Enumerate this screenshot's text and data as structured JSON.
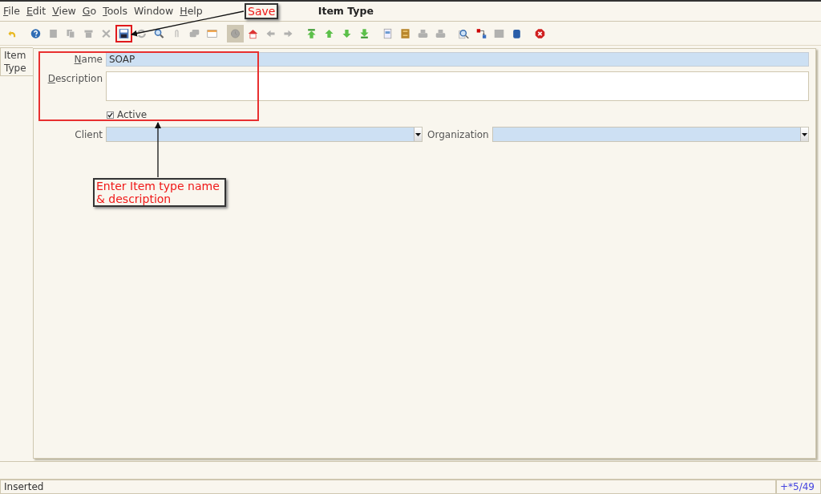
{
  "window": {
    "title": "Item Type"
  },
  "menu": [
    {
      "label": "File",
      "underline_first": true
    },
    {
      "label": "Edit",
      "underline_first": true
    },
    {
      "label": "View",
      "underline_first": true
    },
    {
      "label": "Go",
      "underline_first": true
    },
    {
      "label": "Tools",
      "underline_first": true
    },
    {
      "label": "Window",
      "underline_first": false
    },
    {
      "label": "Help",
      "underline_first": true
    }
  ],
  "toolbar_groups": [
    [
      {
        "kind": "undo",
        "disabled": false,
        "pressed": false,
        "highlighted": false
      }
    ],
    [
      {
        "kind": "help",
        "disabled": false,
        "pressed": false,
        "highlighted": false
      },
      {
        "kind": "new",
        "disabled": true,
        "pressed": false,
        "highlighted": false
      },
      {
        "kind": "copy",
        "disabled": true,
        "pressed": false,
        "highlighted": false
      },
      {
        "kind": "delete",
        "disabled": true,
        "pressed": false,
        "highlighted": false
      },
      {
        "kind": "delete-selection",
        "disabled": true,
        "pressed": false,
        "highlighted": false
      },
      {
        "kind": "save",
        "disabled": false,
        "pressed": false,
        "highlighted": true
      },
      {
        "kind": "refresh",
        "disabled": true,
        "pressed": false,
        "highlighted": false
      },
      {
        "kind": "find",
        "disabled": false,
        "pressed": false,
        "highlighted": false
      },
      {
        "kind": "attachment",
        "disabled": true,
        "pressed": false,
        "highlighted": false
      },
      {
        "kind": "chat",
        "disabled": true,
        "pressed": false,
        "highlighted": false
      },
      {
        "kind": "grid",
        "disabled": false,
        "pressed": false,
        "highlighted": false
      }
    ],
    [
      {
        "kind": "history",
        "disabled": true,
        "pressed": true,
        "highlighted": false
      },
      {
        "kind": "home",
        "disabled": false,
        "pressed": false,
        "highlighted": false
      },
      {
        "kind": "back",
        "disabled": true,
        "pressed": false,
        "highlighted": false
      },
      {
        "kind": "forward",
        "disabled": true,
        "pressed": false,
        "highlighted": false
      }
    ],
    [
      {
        "kind": "first",
        "disabled": false,
        "pressed": false,
        "highlighted": false
      },
      {
        "kind": "previous",
        "disabled": false,
        "pressed": false,
        "highlighted": false
      },
      {
        "kind": "next",
        "disabled": false,
        "pressed": false,
        "highlighted": false
      },
      {
        "kind": "last",
        "disabled": false,
        "pressed": false,
        "highlighted": false
      }
    ],
    [
      {
        "kind": "report",
        "disabled": false,
        "pressed": false,
        "highlighted": false
      },
      {
        "kind": "archive",
        "disabled": false,
        "pressed": false,
        "highlighted": false
      },
      {
        "kind": "print-preview",
        "disabled": true,
        "pressed": false,
        "highlighted": false
      },
      {
        "kind": "print",
        "disabled": true,
        "pressed": false,
        "highlighted": false
      }
    ],
    [
      {
        "kind": "zoom",
        "disabled": false,
        "pressed": false,
        "highlighted": false
      },
      {
        "kind": "request",
        "disabled": false,
        "pressed": false,
        "highlighted": false
      },
      {
        "kind": "product",
        "disabled": true,
        "pressed": false,
        "highlighted": false
      },
      {
        "kind": "workflow",
        "disabled": false,
        "pressed": false,
        "highlighted": false
      }
    ],
    [
      {
        "kind": "exit",
        "disabled": false,
        "pressed": false,
        "highlighted": false
      }
    ]
  ],
  "tabs": [
    {
      "label": "Item Type",
      "selected": true
    }
  ],
  "form": {
    "name": {
      "label": "Name",
      "underline_first": true,
      "value": "SOAP"
    },
    "description": {
      "label": "Description",
      "underline_first": true
    },
    "active": {
      "label": "Active",
      "checked": true
    },
    "client": {
      "label": "Client"
    },
    "organization": {
      "label": "Organization"
    }
  },
  "annotations": [
    {
      "kind": "frame"
    },
    {
      "kind": "arrow"
    },
    {
      "kind": "callout",
      "text": "Save"
    },
    {
      "kind": "arrow"
    },
    {
      "kind": "callout",
      "text": "Enter Item type name & description"
    }
  ],
  "status_bar": {
    "message": "Inserted",
    "record": "+*5/49"
  }
}
